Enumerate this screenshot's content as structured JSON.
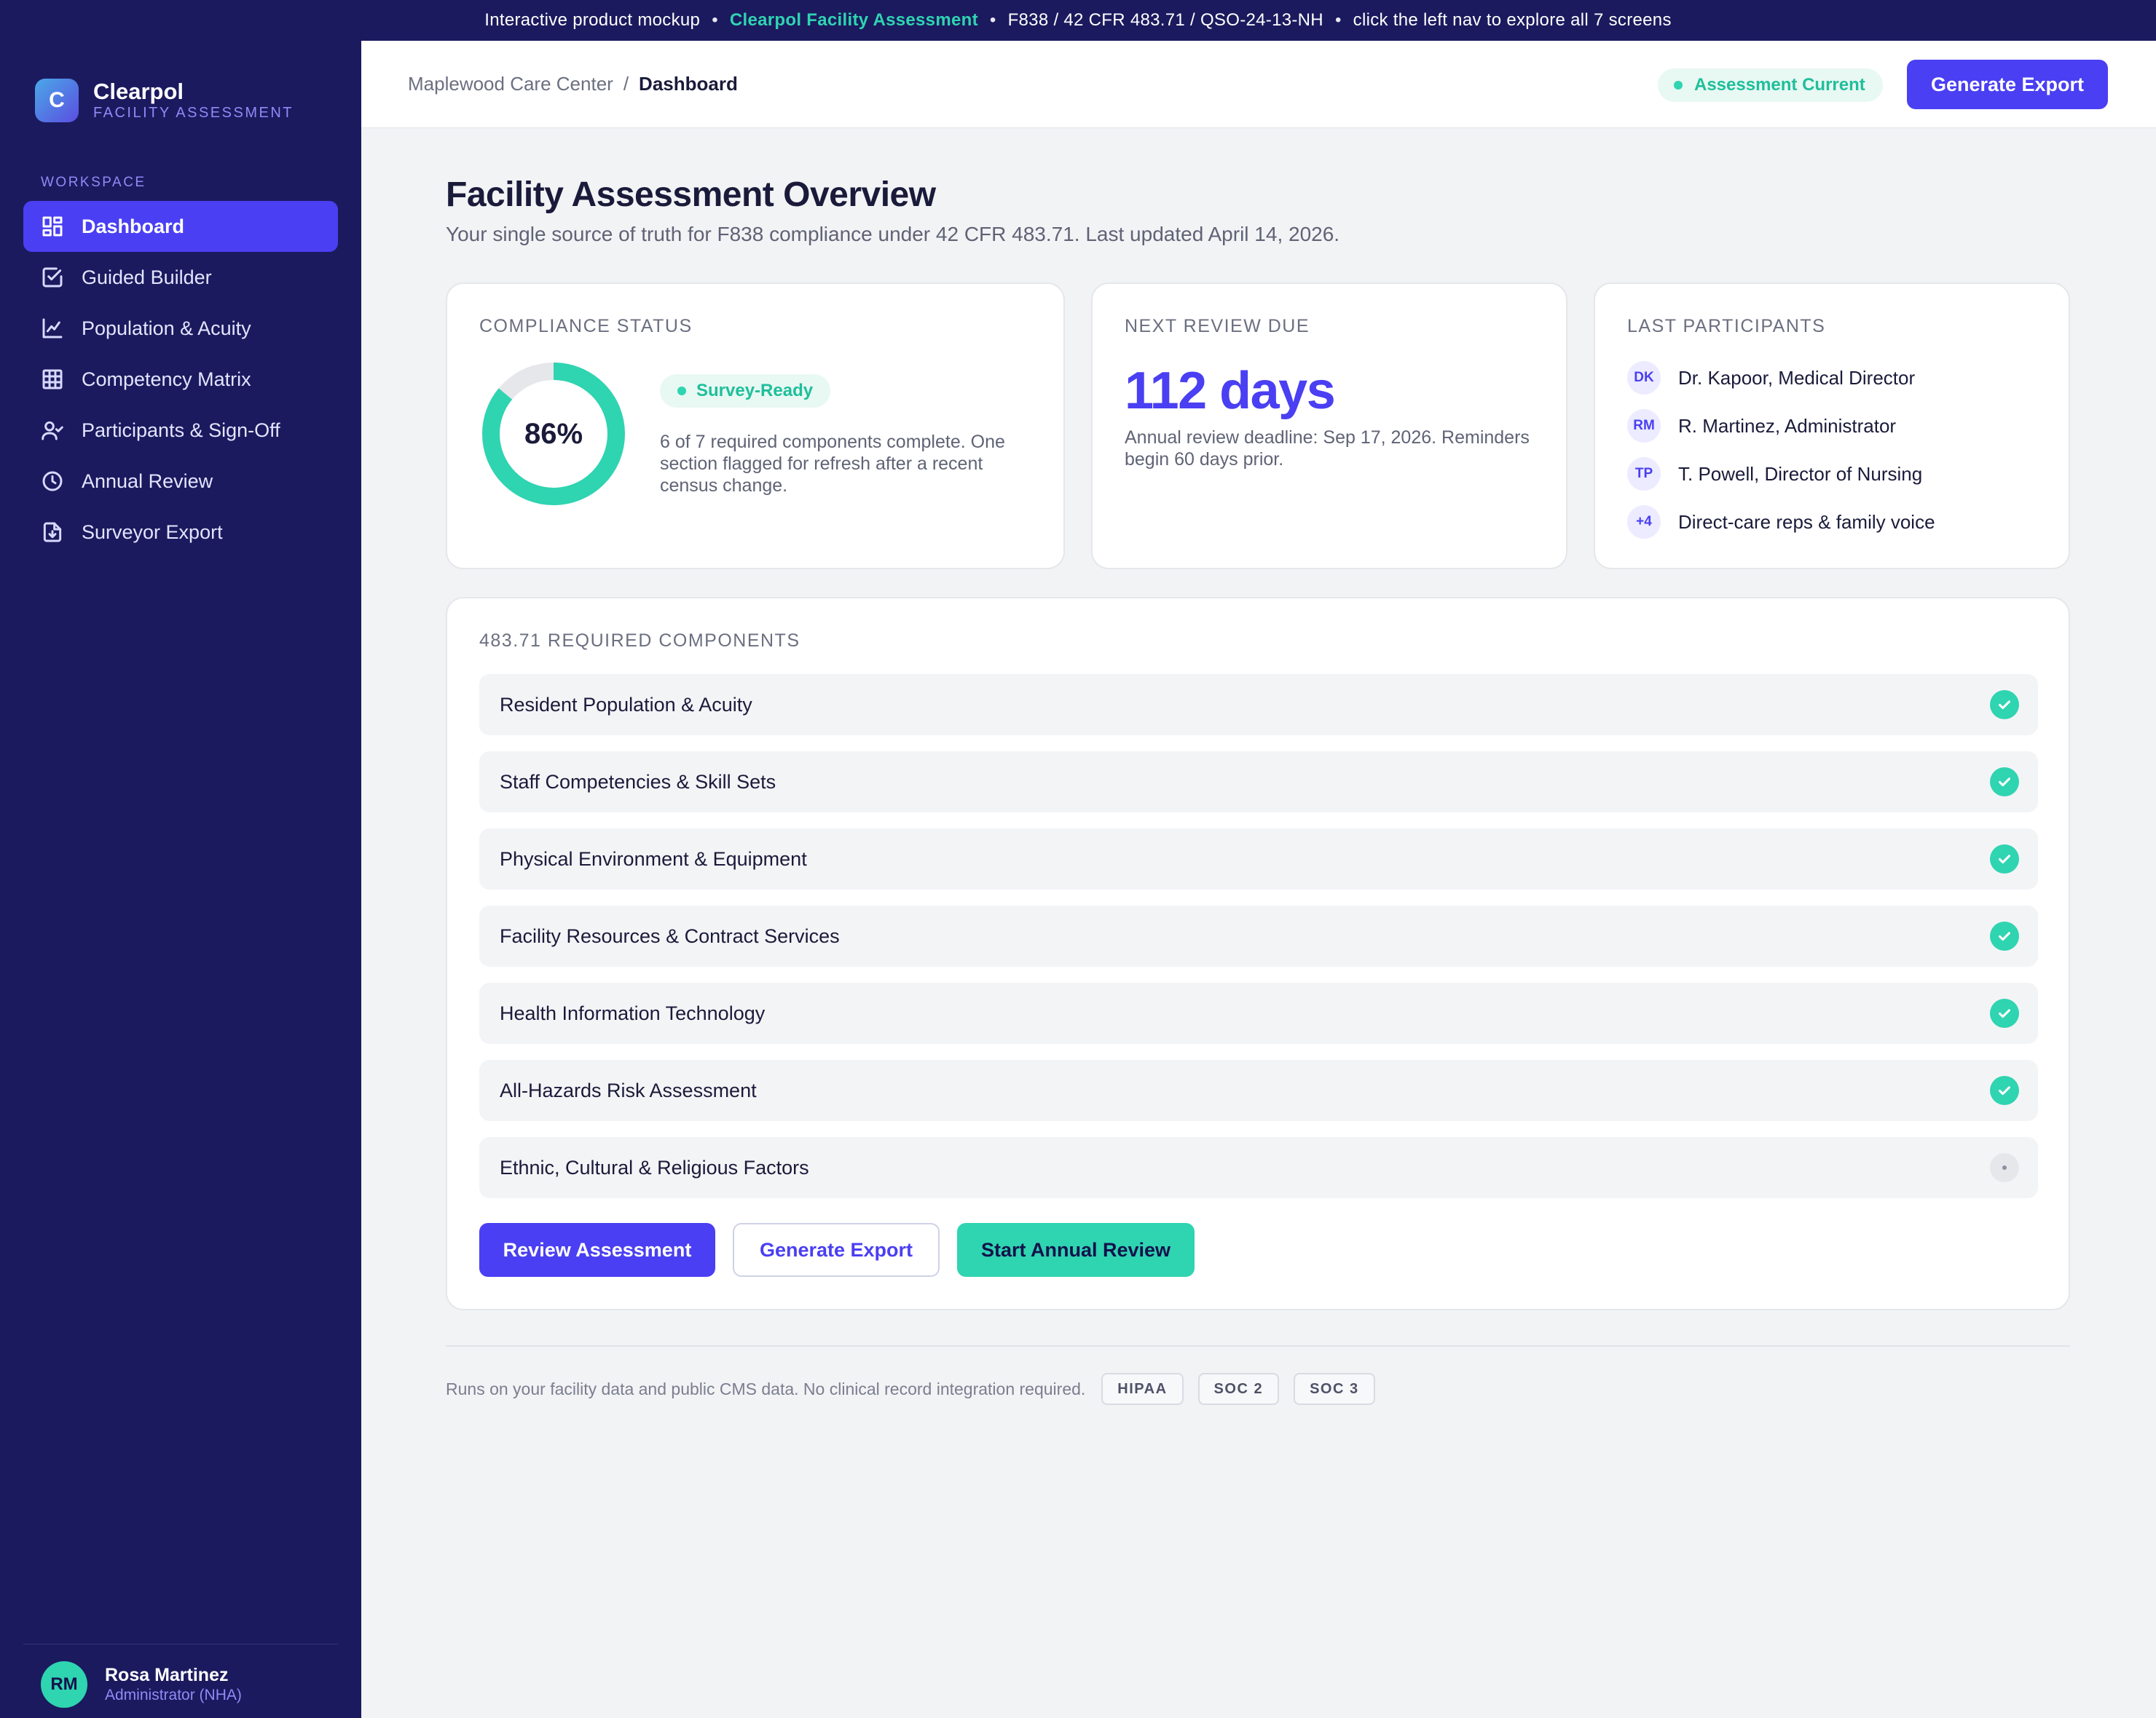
{
  "banner": {
    "prefix": "Interactive product mockup",
    "product": "Clearpol Facility Assessment",
    "regs": "F838 / 42 CFR 483.71 / QSO-24-13-NH",
    "hint": "click the left nav to explore all 7 screens",
    "separator": "•"
  },
  "brand": {
    "logo_letter": "C",
    "name": "Clearpol",
    "sub": "FACILITY ASSESSMENT"
  },
  "sidebar": {
    "section_label": "WORKSPACE",
    "items": [
      {
        "label": "Dashboard",
        "icon": "dashboard-grid-icon",
        "active": true
      },
      {
        "label": "Guided Builder",
        "icon": "checkbox-icon",
        "active": false
      },
      {
        "label": "Population & Acuity",
        "icon": "line-chart-icon",
        "active": false
      },
      {
        "label": "Competency Matrix",
        "icon": "table-grid-icon",
        "active": false
      },
      {
        "label": "Participants & Sign-Off",
        "icon": "user-check-icon",
        "active": false
      },
      {
        "label": "Annual Review",
        "icon": "clock-icon",
        "active": false
      },
      {
        "label": "Surveyor Export",
        "icon": "file-download-icon",
        "active": false
      }
    ]
  },
  "user": {
    "initials": "RM",
    "name": "Rosa Martinez",
    "role": "Administrator (NHA)"
  },
  "header": {
    "facility": "Maplewood Care Center",
    "crumb_sep": "/",
    "current": "Dashboard",
    "status": "Assessment Current",
    "export_label": "Generate Export"
  },
  "main": {
    "title": "Facility Assessment Overview",
    "subtitle": "Your single source of truth for F838 compliance under 42 CFR 483.71. Last updated April 14, 2026."
  },
  "compliance": {
    "label": "COMPLIANCE STATUS",
    "percent_text": "86%",
    "percent_value": 0.86,
    "badge": "Survey-Ready",
    "description": "6 of 7 required components complete. One section flagged for refresh after a recent census change."
  },
  "next_review": {
    "label": "NEXT REVIEW DUE",
    "days": "112 days",
    "description": "Annual review deadline: Sep 17, 2026. Reminders begin 60 days prior."
  },
  "participants": {
    "label": "LAST PARTICIPANTS",
    "items": [
      {
        "initials": "DK",
        "name": "Dr. Kapoor, Medical Director"
      },
      {
        "initials": "RM",
        "name": "R. Martinez, Administrator"
      },
      {
        "initials": "TP",
        "name": "T. Powell, Director of Nursing"
      },
      {
        "initials": "+4",
        "name": "Direct-care reps & family voice"
      }
    ]
  },
  "components": {
    "label": "483.71 REQUIRED COMPONENTS",
    "items": [
      {
        "name": "Resident Population & Acuity",
        "complete": true
      },
      {
        "name": "Staff Competencies & Skill Sets",
        "complete": true
      },
      {
        "name": "Physical Environment & Equipment",
        "complete": true
      },
      {
        "name": "Facility Resources & Contract Services",
        "complete": true
      },
      {
        "name": "Health Information Technology",
        "complete": true
      },
      {
        "name": "All-Hazards Risk Assessment",
        "complete": true
      },
      {
        "name": "Ethnic, Cultural & Religious Factors",
        "complete": false
      }
    ],
    "actions": {
      "review": "Review Assessment",
      "export": "Generate Export",
      "annual": "Start Annual Review"
    }
  },
  "footer": {
    "text": "Runs on your facility data and public CMS data. No clinical record integration required.",
    "badges": [
      "HIPAA",
      "SOC 2",
      "SOC 3"
    ]
  },
  "colors": {
    "navy": "#1b1a5e",
    "primary": "#4a3ff2",
    "teal": "#2fd4b1",
    "background": "#f2f3f5"
  }
}
